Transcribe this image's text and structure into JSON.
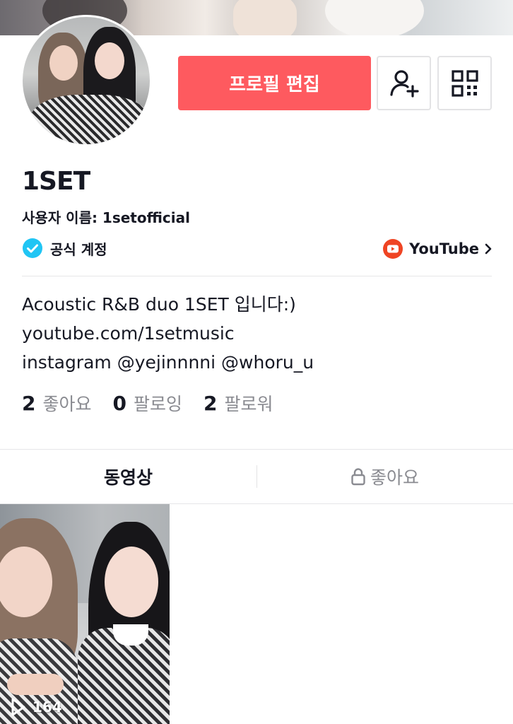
{
  "profile": {
    "edit_button_label": "프로필 편집",
    "display_name": "1SET",
    "username_label": "사용자 이름: 1setofficial",
    "verified_label": "공식 계정",
    "youtube_label": "YouTube",
    "bio_lines": [
      "Acoustic R&B duo 1SET 입니다:)",
      "youtube.com/1setmusic",
      "instagram @yejinnnni @whoru_u"
    ]
  },
  "stats": [
    {
      "value": "2",
      "label": "좋아요"
    },
    {
      "value": "0",
      "label": "팔로잉"
    },
    {
      "value": "2",
      "label": "팔로워"
    }
  ],
  "tabs": [
    {
      "label": "동영상",
      "active": true
    },
    {
      "label": "좋아요",
      "active": false,
      "locked": true
    }
  ],
  "videos": [
    {
      "play_count": "164"
    }
  ],
  "colors": {
    "accent": "#fe5a5f",
    "verified": "#20c5f4",
    "youtube": "#ef4423"
  },
  "icons": {
    "add_friend": "add-user-icon",
    "qr": "qr-code-icon",
    "verified": "verified-badge-icon",
    "youtube": "youtube-icon",
    "chevron": "chevron-right-icon",
    "lock": "lock-icon",
    "play": "play-icon"
  }
}
